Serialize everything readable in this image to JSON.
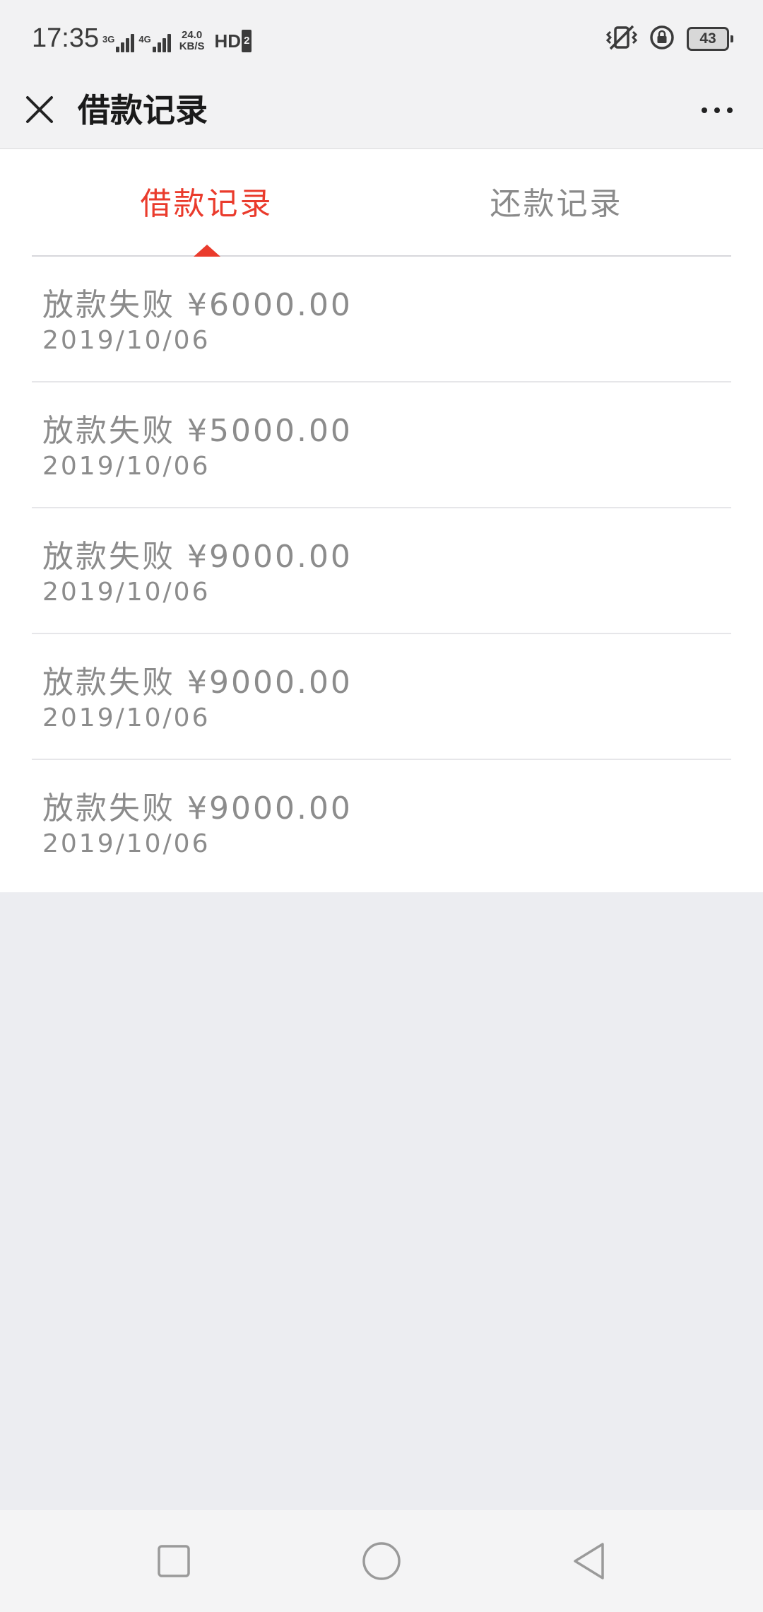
{
  "status_bar": {
    "time": "17:35",
    "signal1_label": "3G",
    "signal2_label": "4G",
    "speed_value": "24.0",
    "speed_unit": "KB/S",
    "hd_label": "HD",
    "hd_sub": "2",
    "battery_level": "43"
  },
  "header": {
    "title": "借款记录"
  },
  "tabs": [
    {
      "label": "借款记录",
      "active": true
    },
    {
      "label": "还款记录",
      "active": false
    }
  ],
  "records": [
    {
      "title": "放款失败 ¥6000.00",
      "date": "2019/10/06"
    },
    {
      "title": "放款失败 ¥5000.00",
      "date": "2019/10/06"
    },
    {
      "title": "放款失败 ¥9000.00",
      "date": "2019/10/06"
    },
    {
      "title": "放款失败 ¥9000.00",
      "date": "2019/10/06"
    },
    {
      "title": "放款失败 ¥9000.00",
      "date": "2019/10/06"
    }
  ],
  "colors": {
    "accent": "#ea3b2c",
    "muted_text": "#8c8c8c",
    "page_background": "#ecedf1"
  },
  "icons": {
    "close": "close-icon",
    "more": "more-icon",
    "nav_recents": "square-icon",
    "nav_home": "circle-icon",
    "nav_back": "triangle-back-icon"
  }
}
